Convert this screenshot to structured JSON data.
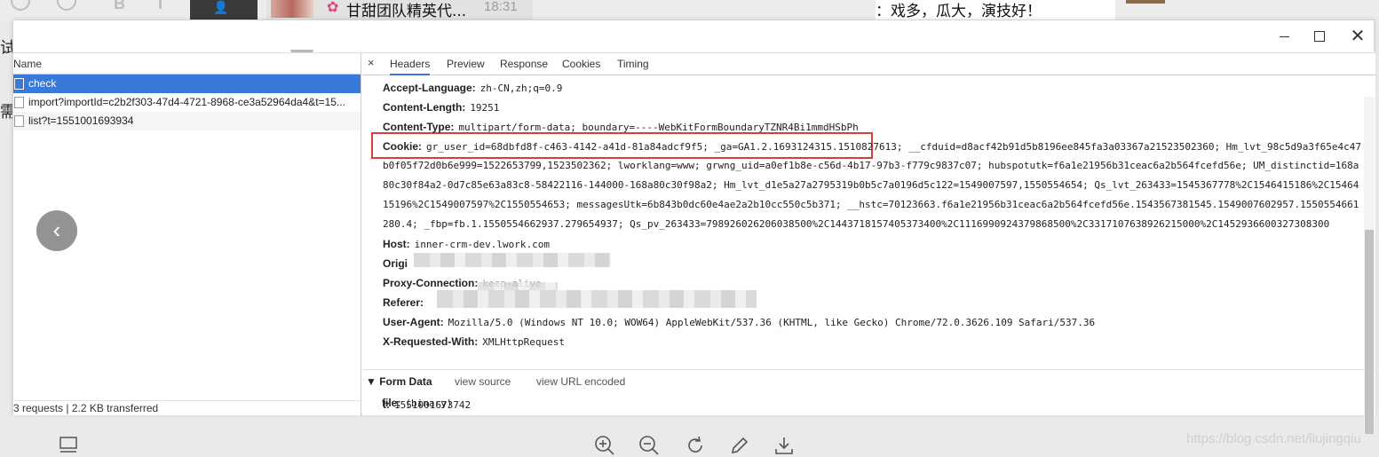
{
  "background": {
    "conversation_title": "甘甜团队精英代...",
    "conversation_time": "18:31",
    "chat_bubble_text": "：戏多，瓜大，演技好！",
    "side_char_top": "试",
    "side_char_mid": "需"
  },
  "window": {
    "minimize_icon": "minimize-icon",
    "maximize_icon": "maximize-icon",
    "close_symbol": "✕"
  },
  "network": {
    "column_header": "Name",
    "requests": [
      {
        "name": "check",
        "selected": true
      },
      {
        "name": "import?importId=c2b2f303-47d4-4721-8968-ce3a52964da4&t=15...",
        "selected": false
      },
      {
        "name": "list?t=1551001693934",
        "selected": false
      }
    ],
    "status_text": "3 requests  |  2.2 KB transferred"
  },
  "detail": {
    "close_symbol": "×",
    "tabs": [
      "Headers",
      "Preview",
      "Response",
      "Cookies",
      "Timing"
    ],
    "active_tab": "Headers",
    "headers": {
      "accept_language": {
        "name": "Accept-Language:",
        "value": "zh-CN,zh;q=0.9"
      },
      "content_length": {
        "name": "Content-Length:",
        "value": "19251"
      },
      "content_type": {
        "name": "Content-Type:",
        "value": "multipart/form-data; boundary=----WebKitFormBoundaryTZNR4Bi1mmdHSbPh"
      },
      "cookie_name": "Cookie:",
      "cookie_lines": [
        "gr_user_id=68dbfd8f-c463-4142-a41d-81a84adcf9f5; _ga=GA1.2.1693124315.1510827613; __cfduid=d8acf42b91d5b8196ee845fa3a03367a21523502360; Hm_lvt_98c5d9a3f65e4c47",
        "b0f05f72d0b6e999=1522653799,1523502362; lworklang=www; grwng_uid=a0ef1b8e-c56d-4b17-97b3-f779c9837c07; hubspotutk=f6a1e21956b31ceac6a2b564fcefd56e; UM_distinctid=168a",
        "80c30f84a2-0d7c85e63a83c8-58422116-144000-168a80c30f98a2; Hm_lvt_d1e5a27a2795319b0b5c7a0196d5c122=1549007597,1550554654; Qs_lvt_263433=1545367778%2C1546415186%2C15464",
        "15196%2C1549007597%2C1550554653; messagesUtk=6b843b0dc60e4ae2a2b10cc550c5b371; __hstc=70123663.f6a1e21956b31ceac6a2b564fcefd56e.1543567381545.1549007602957.1550554661",
        "280.4; _fbp=fb.1.1550554662937.279654937; Qs_pv_263433=798926026206038500%2C1443718157405373400%2C1116990924379868500%2C3317107638926215000%2C1452936600327308300"
      ],
      "host": {
        "name": "Host:",
        "value": "inner-crm-dev.lwork.com"
      },
      "origin": {
        "name": "Origi"
      },
      "proxy_connection": {
        "name": "Proxy-Connection:",
        "value": "keep-alive"
      },
      "referer": {
        "name": "Referer:"
      },
      "user_agent": {
        "name": "User-Agent:",
        "value": "Mozilla/5.0 (Windows NT 10.0; WOW64) AppleWebKit/537.36 (KHTML, like Gecko) Chrome/72.0.3626.109 Safari/537.36"
      },
      "x_requested_with": {
        "name": "X-Requested-With:",
        "value": "XMLHttpRequest"
      }
    },
    "form_data": {
      "title": "▼ Form Data",
      "view_source": "view source",
      "view_url_encoded": "view URL encoded",
      "fields": [
        {
          "name": "t:",
          "value": "1551001673742"
        },
        {
          "name": "file:",
          "value": "(binary)"
        }
      ]
    }
  },
  "viewer": {
    "watermark": "https://blog.csdn.net/liujingqiu"
  }
}
